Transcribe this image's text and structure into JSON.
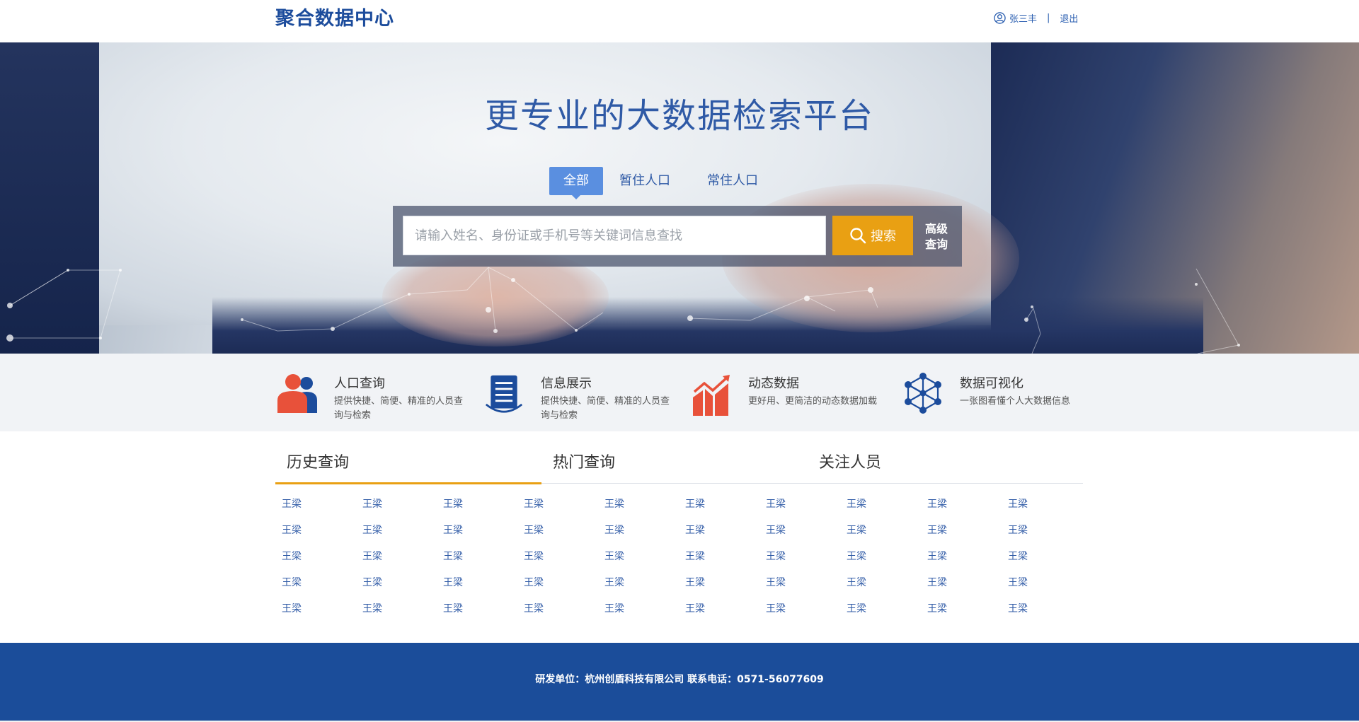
{
  "header": {
    "logo_text": "聚合数据中心",
    "user_name": "张三丰",
    "separator": "|",
    "logout_label": "退出"
  },
  "hero": {
    "title": "更专业的大数据检索平台",
    "tabs": [
      {
        "label": "全部",
        "active": true
      },
      {
        "label": "暂住人口",
        "active": false
      },
      {
        "label": "常住人口",
        "active": false
      }
    ],
    "search": {
      "placeholder": "请输入姓名、身份证或手机号等关键词信息查找",
      "value": "",
      "button_label": "搜索",
      "advanced_label_line1": "高级",
      "advanced_label_line2": "查询"
    }
  },
  "features": [
    {
      "title": "人口查询",
      "desc": "提供快捷、简便、精准的人员查询与检索",
      "icon": "people-icon"
    },
    {
      "title": "信息展示",
      "desc": "提供快捷、简便、精准的人员查询与检索",
      "icon": "document-icon"
    },
    {
      "title": "动态数据",
      "desc": "更好用、更简洁的动态数据加载",
      "icon": "chart-icon"
    },
    {
      "title": "数据可视化",
      "desc": "一张图看懂个人大数据信息",
      "icon": "network-icon"
    }
  ],
  "query_tabs": [
    {
      "label": "历史查询",
      "active": true
    },
    {
      "label": "热门查询",
      "active": false
    },
    {
      "label": "关注人员",
      "active": false
    }
  ],
  "names": [
    "王梁",
    "王梁",
    "王梁",
    "王梁",
    "王梁",
    "王梁",
    "王梁",
    "王梁",
    "王梁",
    "王梁",
    "王梁",
    "王梁",
    "王梁",
    "王梁",
    "王梁",
    "王梁",
    "王梁",
    "王梁",
    "王梁",
    "王梁",
    "王梁",
    "王梁",
    "王梁",
    "王梁",
    "王梁",
    "王梁",
    "王梁",
    "王梁",
    "王梁",
    "王梁",
    "王梁",
    "王梁",
    "王梁",
    "王梁",
    "王梁",
    "王梁",
    "王梁",
    "王梁",
    "王梁",
    "王梁",
    "王梁",
    "王梁",
    "王梁",
    "王梁",
    "王梁",
    "王梁",
    "王梁",
    "王梁",
    "王梁",
    "王梁"
  ],
  "footer": {
    "text": "研发单位：杭州创盾科技有限公司 联系电话：0571-56077609"
  },
  "colors": {
    "brand_blue": "#1b4d9a",
    "link_blue": "#2f5aa6",
    "accent_orange": "#e9a013",
    "tab_blue": "#5a8fe0",
    "icon_red": "#e8513a"
  }
}
